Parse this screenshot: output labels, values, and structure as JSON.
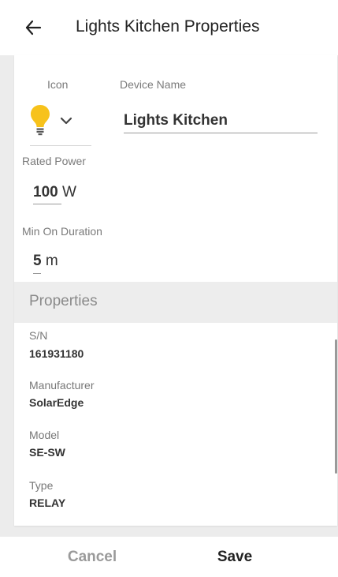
{
  "header": {
    "title": "Lights Kitchen Properties"
  },
  "form": {
    "icon_label": "Icon",
    "icon_name": "lightbulb-icon",
    "device_name_label": "Device Name",
    "device_name_value": "Lights Kitchen",
    "rated_power_label": "Rated Power",
    "rated_power_value": "100",
    "rated_power_unit": "W",
    "min_on_duration_label": "Min On Duration",
    "min_on_duration_value": "5",
    "min_on_duration_unit": "m"
  },
  "properties": {
    "section_title": "Properties",
    "items": [
      {
        "label": "S/N",
        "value": "161931180"
      },
      {
        "label": "Manufacturer",
        "value": "SolarEdge"
      },
      {
        "label": "Model",
        "value": "SE-SW"
      },
      {
        "label": "Type",
        "value": "RELAY"
      }
    ]
  },
  "footer": {
    "cancel_label": "Cancel",
    "save_label": "Save"
  },
  "colors": {
    "bulb": "#f7c21b",
    "backdrop": "#ececec",
    "section_bar": "#ededed"
  }
}
